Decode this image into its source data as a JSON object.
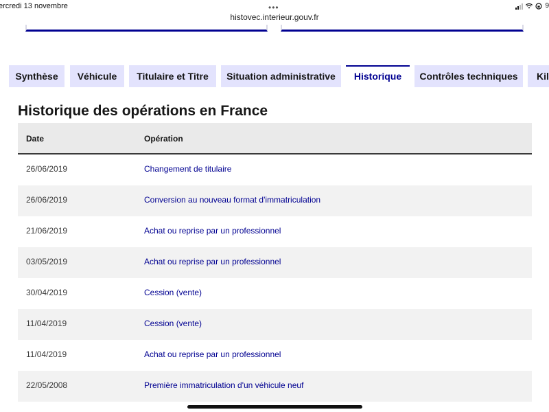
{
  "status_bar": {
    "time_label": "ercredi 13 novembre",
    "battery": "9"
  },
  "browser": {
    "dots": "•••",
    "url": "histovec.interieur.gouv.fr"
  },
  "tabs": [
    {
      "label": "Synthèse",
      "active": false
    },
    {
      "label": "Véhicule",
      "active": false
    },
    {
      "label": "Titulaire et Titre",
      "active": false
    },
    {
      "label": "Situation administrative",
      "active": false
    },
    {
      "label": "Historique",
      "active": true
    },
    {
      "label": "Contrôles techniques",
      "active": false
    },
    {
      "label": "Kilo",
      "active": false
    }
  ],
  "main": {
    "title": "Historique des opérations en France",
    "table": {
      "headers": {
        "date": "Date",
        "operation": "Opération"
      },
      "rows": [
        {
          "date": "26/06/2019",
          "operation": "Changement de titulaire"
        },
        {
          "date": "26/06/2019",
          "operation": "Conversion au nouveau format d'immatriculation"
        },
        {
          "date": "21/06/2019",
          "operation": "Achat ou reprise par un professionnel"
        },
        {
          "date": "03/05/2019",
          "operation": "Achat ou reprise par un professionnel"
        },
        {
          "date": "30/04/2019",
          "operation": "Cession (vente)"
        },
        {
          "date": "11/04/2019",
          "operation": "Cession (vente)"
        },
        {
          "date": "11/04/2019",
          "operation": "Achat ou reprise par un professionnel"
        },
        {
          "date": "22/05/2008",
          "operation": "Première immatriculation d'un véhicule neuf"
        }
      ]
    }
  },
  "colors": {
    "accent": "#000091",
    "tab_bg": "#e3e3fd",
    "row_alt": "#f2f2f2",
    "header_bg": "#eaeaea"
  }
}
